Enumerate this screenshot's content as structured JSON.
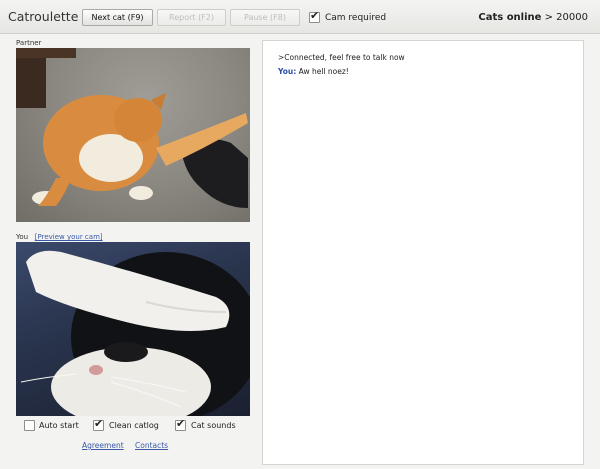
{
  "app_title": "Catroulette",
  "toolbar": {
    "next_label": "Next cat (F9)",
    "report_label": "Report (F2)",
    "pause_label": "Pause (F8)",
    "cam_required_label": "Cam required"
  },
  "status": {
    "label": "Cats online",
    "value": "> 20000"
  },
  "partner": {
    "label": "Partner"
  },
  "self": {
    "label": "You",
    "preview_link": "[Preview your cam]"
  },
  "options": {
    "auto_start": "Auto start",
    "clean_catlog": "Clean catlog",
    "cat_sounds": "Cat sounds"
  },
  "footer": {
    "agreement": "Agreement",
    "contacts": "Contacts"
  },
  "chat": {
    "system_message": ">Connected, feel free to talk now",
    "messages": [
      {
        "speaker": "You:",
        "text": "Aw hell noez!"
      }
    ]
  },
  "colors": {
    "link": "#3a5aa8",
    "speaker": "#2b4fa8"
  }
}
